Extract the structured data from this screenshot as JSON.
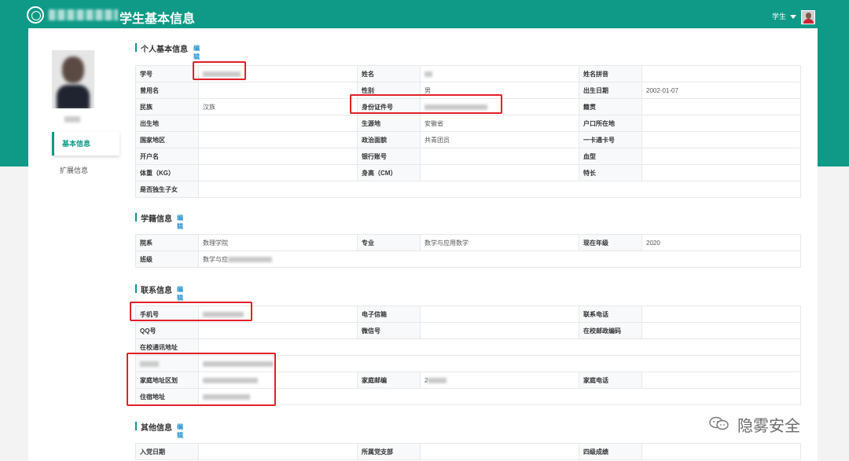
{
  "header": {
    "title": "学生基本信息",
    "role_label": "学生"
  },
  "sidebar": {
    "items": [
      {
        "label": "基本信息",
        "active": true
      },
      {
        "label": "扩展信息",
        "active": false
      }
    ]
  },
  "sections": {
    "personal": {
      "title": "个人基本信息",
      "edit_label": "编辑",
      "rows": [
        [
          "学号",
          "",
          "姓名",
          "",
          "姓名拼音",
          ""
        ],
        [
          "曾用名",
          "",
          "性别",
          "男",
          "出生日期",
          "2002-01-07"
        ],
        [
          "民族",
          "汉族",
          "身份证件号",
          "",
          "籍贯",
          ""
        ],
        [
          "出生地",
          "",
          "生源地",
          "安徽省",
          "户口所在地",
          ""
        ],
        [
          "国家地区",
          "",
          "政治面貌",
          "共青团员",
          "一卡通卡号",
          ""
        ],
        [
          "开户名",
          "",
          "银行账号",
          "",
          "血型",
          ""
        ],
        [
          "体重（KG）",
          "",
          "身高（CM）",
          "",
          "特长",
          ""
        ],
        [
          "是否独生子女",
          ""
        ]
      ]
    },
    "academic": {
      "title": "学籍信息",
      "edit_label": "编辑",
      "rows": [
        [
          "院系",
          "数理学院",
          "专业",
          "数学与应用数学",
          "现在年级",
          "2020"
        ],
        [
          "班级",
          "数学与应"
        ]
      ]
    },
    "contact": {
      "title": "联系信息",
      "edit_label": "编辑",
      "rows": [
        [
          "手机号",
          "",
          "电子信箱",
          "",
          "联系电话",
          ""
        ],
        [
          "QQ号",
          "",
          "微信号",
          "",
          "在校邮政编码",
          ""
        ],
        [
          "在校通讯地址",
          ""
        ],
        [
          "",
          ""
        ],
        [
          "家庭地址区划",
          "",
          "家庭邮编",
          "2",
          "家庭电话",
          ""
        ],
        [
          "住宿地址",
          ""
        ]
      ]
    },
    "other": {
      "title": "其他信息",
      "edit_label": "编辑",
      "rows": [
        [
          "入党日期",
          "",
          "所属党支部",
          "",
          "四级成绩",
          ""
        ]
      ]
    }
  },
  "watermark": {
    "text": "隐雾安全"
  },
  "colors": {
    "brand": "#0e9a86",
    "edit_link": "#1a8fd1",
    "highlight_box": "#e2202a"
  }
}
